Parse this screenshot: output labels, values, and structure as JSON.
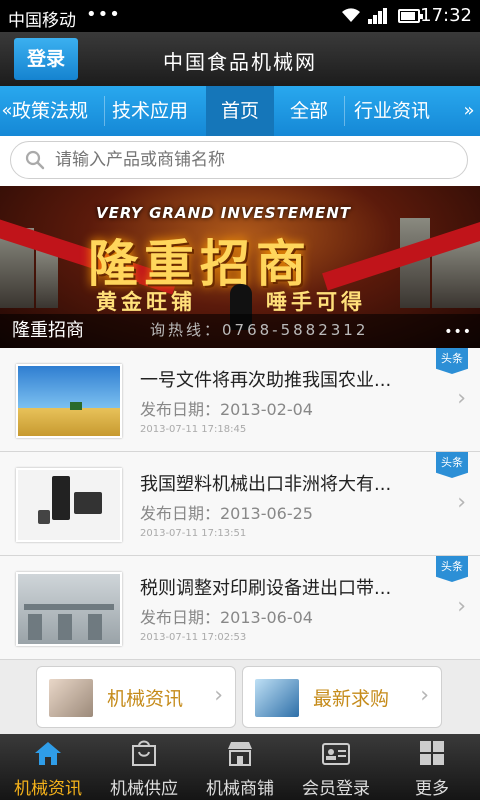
{
  "status_bar": {
    "carrier": "中国移动",
    "notification_dots": "•••",
    "time": "17:32"
  },
  "header": {
    "login_label": "登录",
    "title": "中国食品机械网"
  },
  "nav": {
    "left_arrow": "«",
    "right_arrow": "»",
    "tabs": [
      {
        "label": "政策法规"
      },
      {
        "label": "技术应用"
      },
      {
        "label": "首页"
      },
      {
        "label": "全部"
      },
      {
        "label": "行业资讯"
      }
    ],
    "active_tab": "首页"
  },
  "search": {
    "placeholder": "请输入产品或商铺名称",
    "icon": "search-icon"
  },
  "banner": {
    "english_text": "VERY GRAND INVESTEMENT",
    "headline": "隆重招商",
    "slogan_left": "黄金旺铺",
    "slogan_right": "唾手可得",
    "hotline": "询热线：0768-5882312",
    "caption": "隆重招商",
    "dots": "•••"
  },
  "news": [
    {
      "title": "一号文件将再次助推我国农业...",
      "publish_label": "发布日期：2013-02-04",
      "timestamp": "2013-07-11 17:18:45",
      "badge": "头条"
    },
    {
      "title": "我国塑料机械出口非洲将大有...",
      "publish_label": "发布日期：2013-06-25",
      "timestamp": "2013-07-11 17:13:51",
      "badge": "头条"
    },
    {
      "title": "税则调整对印刷设备进出口带...",
      "publish_label": "发布日期：2013-06-04",
      "timestamp": "2013-07-11 17:02:53",
      "badge": "头条"
    }
  ],
  "quick_links": [
    {
      "label": "机械资讯",
      "chevron": "›"
    },
    {
      "label": "最新求购",
      "chevron": "›"
    }
  ],
  "tabbar": {
    "items": [
      {
        "label": "机械资讯",
        "icon": "home-icon"
      },
      {
        "label": "机械供应",
        "icon": "bag-icon"
      },
      {
        "label": "机械商铺",
        "icon": "shop-icon"
      },
      {
        "label": "会员登录",
        "icon": "member-card-icon"
      },
      {
        "label": "更多",
        "icon": "grid-icon"
      }
    ],
    "active_index": 0
  },
  "colors": {
    "accent": "#1e90dc",
    "active_tab": "#f5b21a",
    "quick_label": "#c58b1a"
  }
}
